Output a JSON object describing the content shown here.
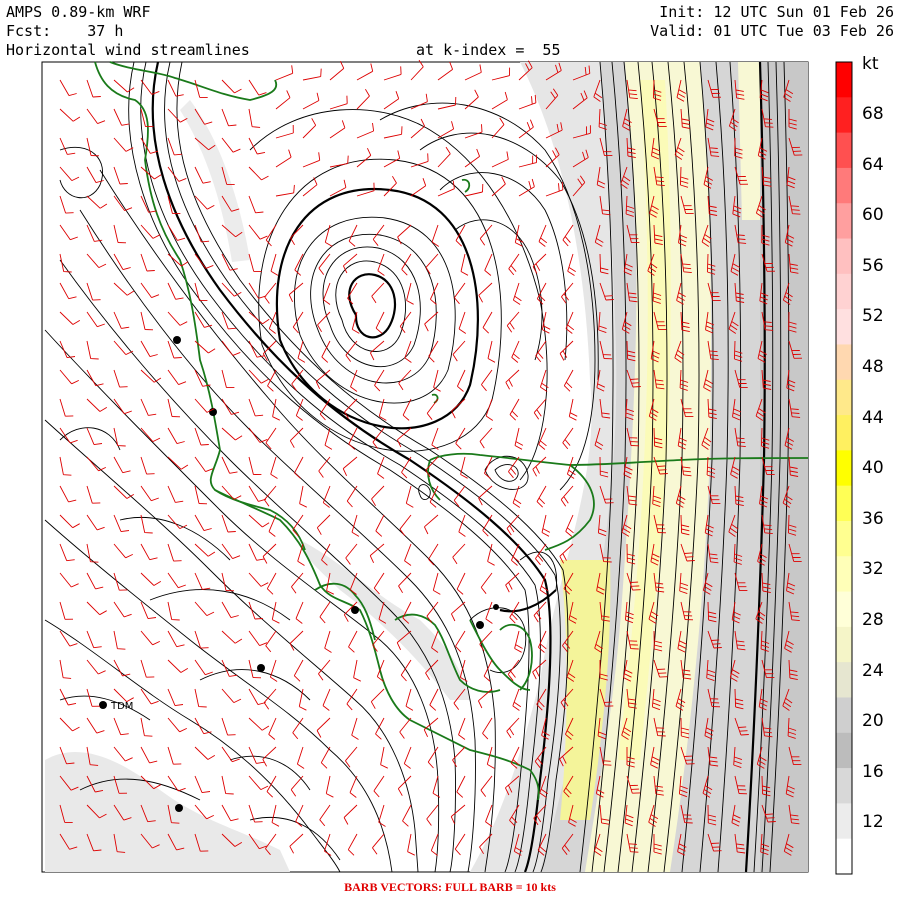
{
  "header": {
    "model": "AMPS 0.89-km WRF",
    "forecast": "Fcst:    37 h",
    "field": "Horizontal wind streamlines",
    "level": "at k-index =  55",
    "init": "Init: 12 UTC Sun 01 Feb 26",
    "valid": "Valid: 01 UTC Tue 03 Feb 26"
  },
  "colorbar": {
    "unit": "kt",
    "labels": [
      "68",
      "64",
      "60",
      "56",
      "52",
      "48",
      "44",
      "40",
      "36",
      "32",
      "28",
      "24",
      "20",
      "16",
      "12"
    ],
    "colors": [
      "#ff0000",
      "#ff2020",
      "#ff5050",
      "#ff7a7a",
      "#ff9f9f",
      "#ffc0c0",
      "#ffd2d2",
      "#ffe0e0",
      "#ffd8b0",
      "#ffe98a",
      "#fff060",
      "#ffff00",
      "#ffff55",
      "#ffff90",
      "#ffffb8",
      "#ffffd8",
      "#f5f5c8",
      "#e6e6d0",
      "#cfcfcf",
      "#bcbcbc",
      "#d8d8d8",
      "#ececec",
      "#ffffff"
    ]
  },
  "station": {
    "label": "TDM"
  },
  "footer": "BARB VECTORS:  FULL BARB = 10 kts",
  "colors": {
    "coast": "#1a7a1a",
    "barb": "#dd0000",
    "streamline": "#000000"
  }
}
